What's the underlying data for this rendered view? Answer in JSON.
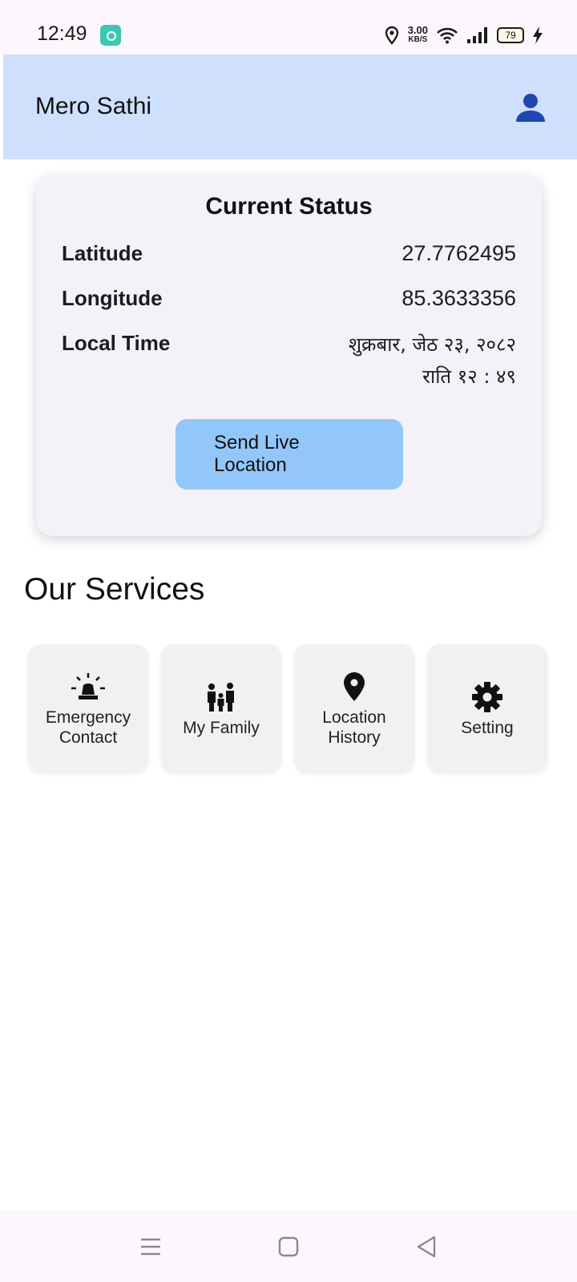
{
  "status_bar": {
    "time": "12:49",
    "speed_value": "3.00",
    "speed_unit": "KB/S",
    "battery": "79",
    "icons": [
      "app-notification-icon",
      "location-icon",
      "wifi-icon",
      "signal-icon",
      "battery-icon",
      "charging-icon"
    ]
  },
  "appbar": {
    "title": "Mero Sathi",
    "profile_icon": "person-icon",
    "color": "#cfe0fc"
  },
  "status_card": {
    "title": "Current Status",
    "latitude_label": "Latitude",
    "latitude_value": "27.7762495",
    "longitude_label": "Longitude",
    "longitude_value": "85.3633356",
    "local_time_label": "Local Time",
    "local_time_line1": "शुक्रबार, जेठ २३, २०८२",
    "local_time_line2": "राति १२ : ४९",
    "send_button": "Send Live Location",
    "button_color": "#93c7fa"
  },
  "services": {
    "title": "Our Services",
    "items": [
      {
        "label": "Emergency Contact",
        "icon": "siren-icon"
      },
      {
        "label": "My Family",
        "icon": "family-icon"
      },
      {
        "label": "Location History",
        "icon": "location-pin-icon"
      },
      {
        "label": "Setting",
        "icon": "gear-icon"
      }
    ]
  },
  "navbar": {
    "icons": [
      "menu-icon",
      "home-icon",
      "back-icon"
    ]
  }
}
